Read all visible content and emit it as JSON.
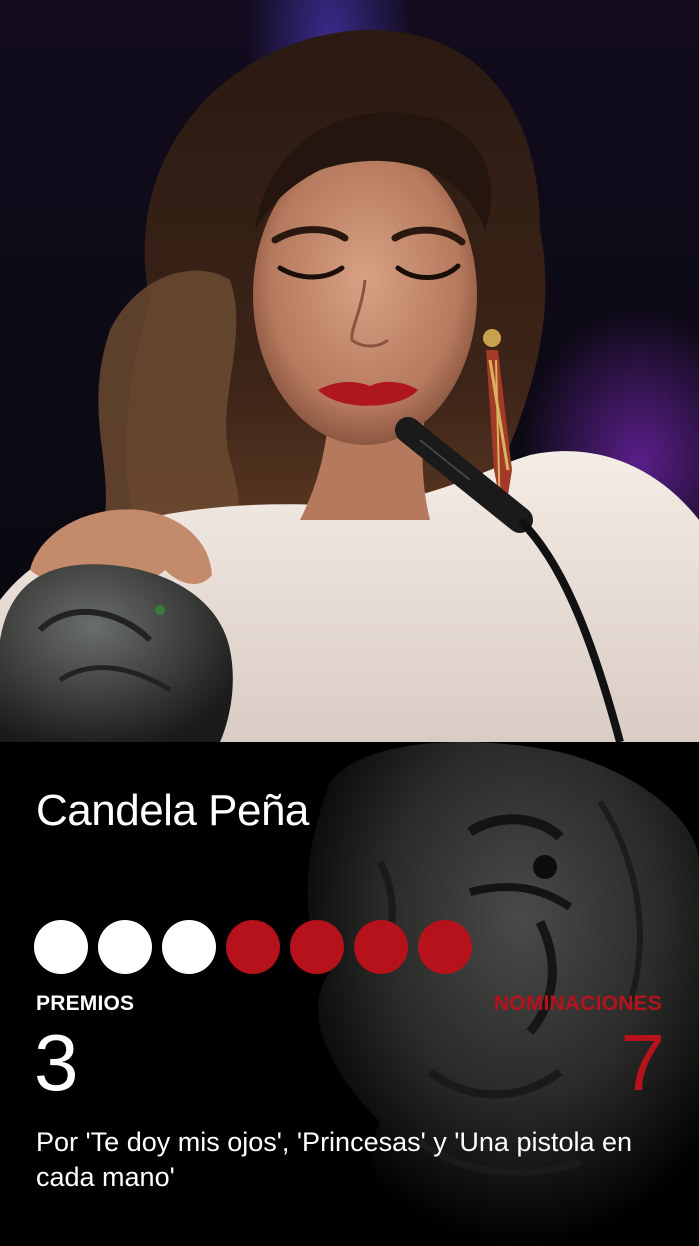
{
  "person": {
    "name": "Candela Peña"
  },
  "record": {
    "won": 3,
    "nominated": 7
  },
  "stats": {
    "awards_label": "PREMIOS",
    "awards_value": "3",
    "nominations_label": "NOMINACIONES",
    "nominations_value": "7"
  },
  "description": "Por 'Te doy mis ojos', 'Princesas' y 'Una pistola en cada mano'",
  "colors": {
    "background": "#000000",
    "won_dot": "#ffffff",
    "nomination_dot": "#b5121b",
    "text": "#ffffff",
    "accent": "#b5121b"
  }
}
